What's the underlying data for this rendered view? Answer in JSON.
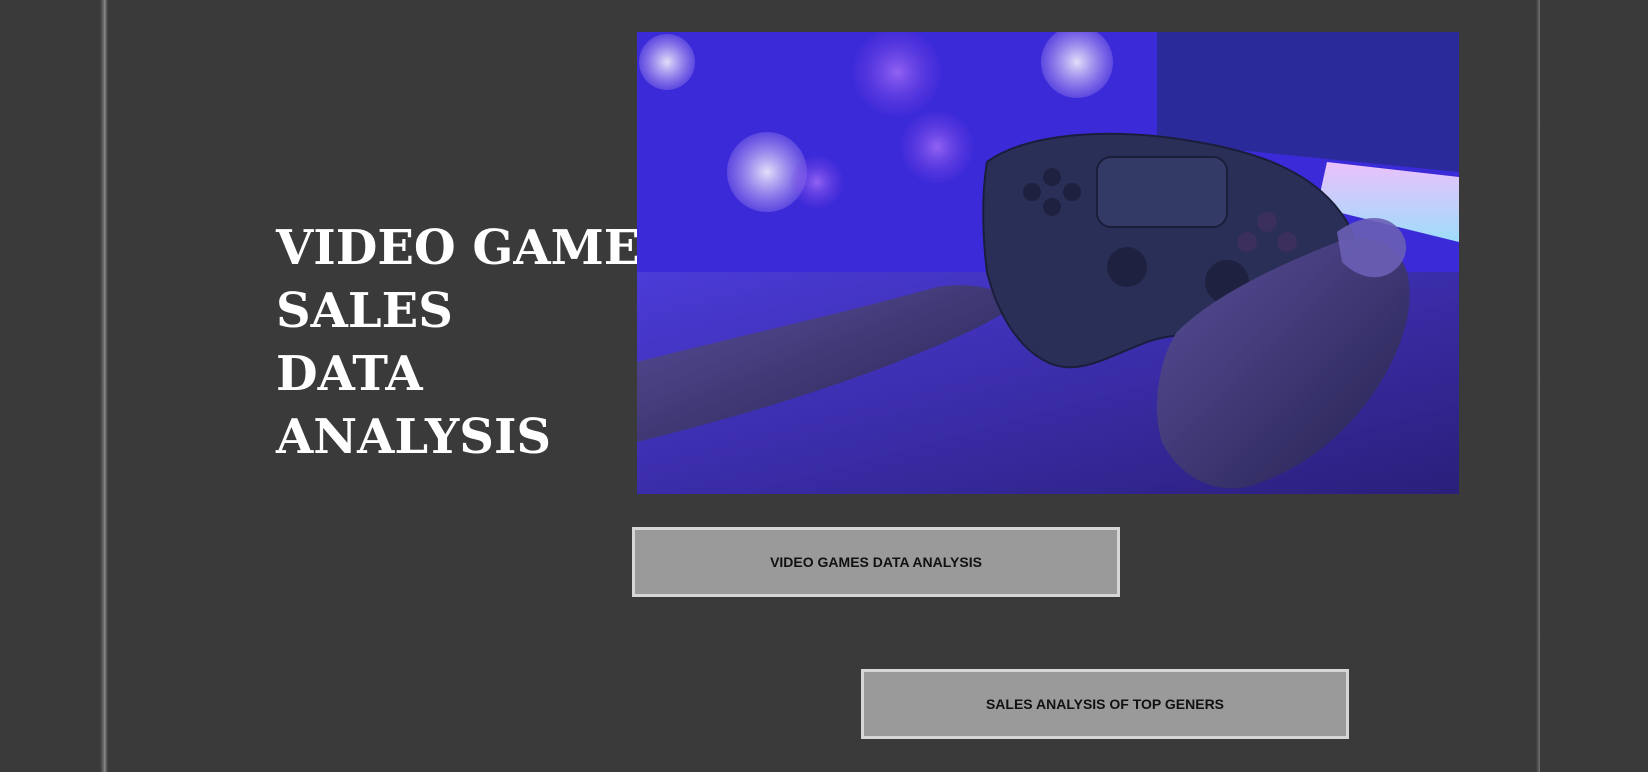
{
  "title": {
    "line1": "VIDEO GAMES",
    "line2": "SALES",
    "line3": "DATA",
    "line4": "ANALYSIS"
  },
  "hero_image": {
    "icon": "gamepad-photo",
    "accent_colors": [
      "#7b3fe4",
      "#3a2ad8",
      "#d06be6"
    ]
  },
  "buttons": {
    "data_analysis_label": "VIDEO GAMES DATA ANALYSIS",
    "top_genres_label": "SALES ANALYSIS OF TOP GENERS"
  },
  "colors": {
    "background": "#3a3a3a",
    "button_fill": "#9a9a9a",
    "button_border": "#d6d6d6",
    "title_text": "#ffffff"
  }
}
